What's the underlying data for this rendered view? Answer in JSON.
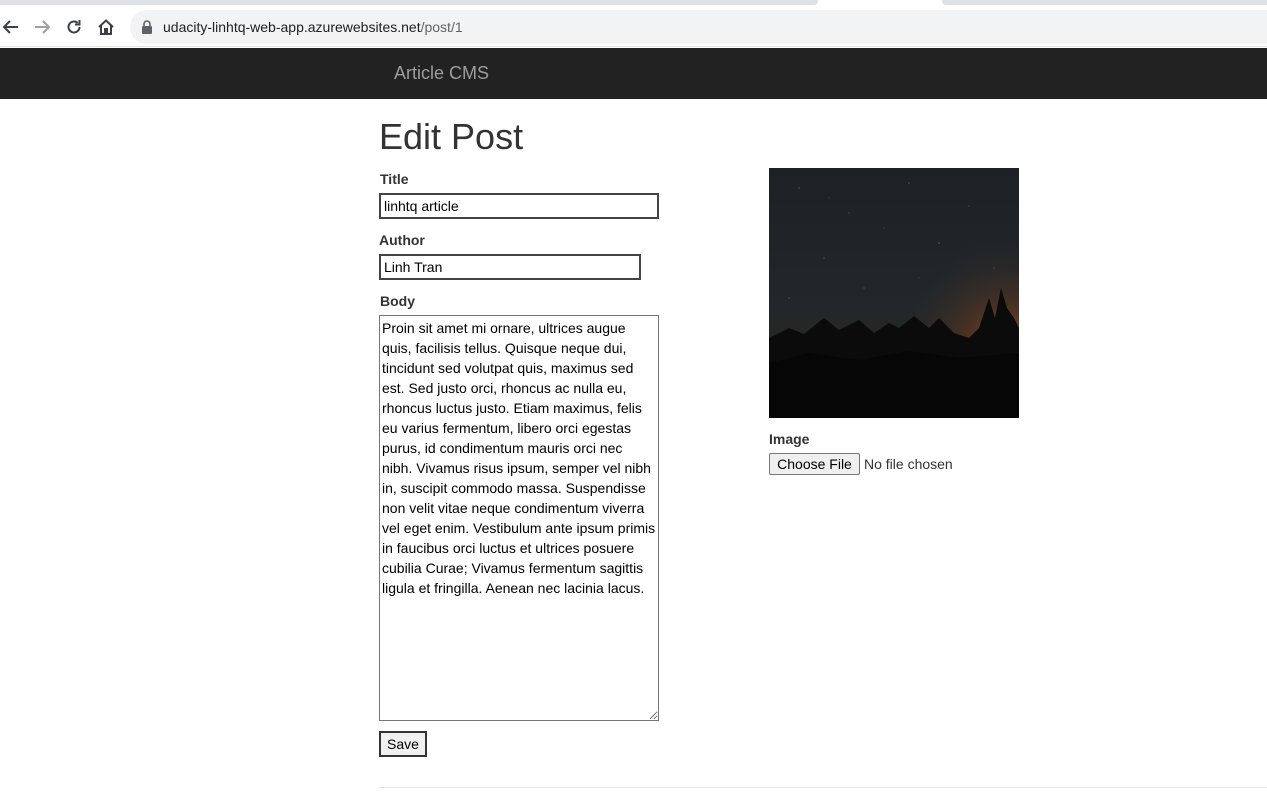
{
  "browser": {
    "url_domain": "udacity-linhtq-web-app.azurewebsites.net",
    "url_path": "/post/1"
  },
  "navbar": {
    "brand": "Article CMS"
  },
  "page": {
    "title": "Edit Post"
  },
  "form": {
    "title_label": "Title",
    "title_value": "linhtq article",
    "author_label": "Author",
    "author_value": "Linh Tran",
    "body_label": "Body",
    "body_value": "Proin sit amet mi ornare, ultrices augue quis, facilisis tellus. Quisque neque dui, tincidunt sed volutpat quis, maximus sed est. Sed justo orci, rhoncus ac nulla eu, rhoncus luctus justo. Etiam maximus, felis eu varius fermentum, libero orci egestas purus, id condimentum mauris orci nec nibh. Vivamus risus ipsum, semper vel nibh in, suscipit commodo massa. Suspendisse non velit vitae neque condimentum viverra vel eget enim. Vestibulum ante ipsum primis in faucibus orci luctus et ultrices posuere cubilia Curae; Vivamus fermentum sagittis ligula et fringilla. Aenean nec lacinia lacus.",
    "save_label": "Save",
    "image_label": "Image",
    "file_button_label": "Choose File",
    "file_status": "No file chosen"
  },
  "icons": {
    "back": "arrow-left-icon",
    "forward": "arrow-right-icon",
    "reload": "reload-icon",
    "home": "home-icon",
    "lock": "lock-icon"
  },
  "colors": {
    "navbar_bg": "#222222",
    "brand_text": "#9d9d9d"
  }
}
